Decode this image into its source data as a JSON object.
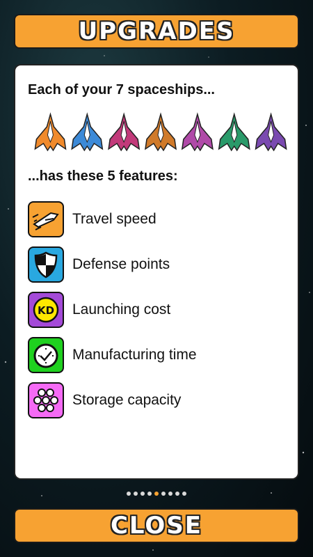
{
  "header": {
    "title": "UPGRADES"
  },
  "card": {
    "ships_heading": "Each of your 7 spaceships...",
    "features_heading": "...has these 5 features:",
    "ships": [
      {
        "icon": "ship-1-icon",
        "color": "#f08a2c"
      },
      {
        "icon": "ship-2-icon",
        "color": "#3c8ad8"
      },
      {
        "icon": "ship-3-icon",
        "color": "#c23a7a"
      },
      {
        "icon": "ship-4-icon",
        "color": "#d07a2a"
      },
      {
        "icon": "ship-5-icon",
        "color": "#b04aa8"
      },
      {
        "icon": "ship-6-icon",
        "color": "#2a9a6a"
      },
      {
        "icon": "ship-7-icon",
        "color": "#7a4ab0"
      }
    ],
    "features": [
      {
        "label": "Travel speed",
        "icon": "speed-ship-icon",
        "color": "#f7a232"
      },
      {
        "label": "Defense points",
        "icon": "shield-icon",
        "color": "#29a8e0"
      },
      {
        "label": "Launching cost",
        "icon": "kd-coin-icon",
        "color": "#a44ad8"
      },
      {
        "label": "Manufacturing time",
        "icon": "clock-icon",
        "color": "#1fd11f"
      },
      {
        "label": "Storage capacity",
        "icon": "storage-grid-icon",
        "color": "#f56af5"
      }
    ]
  },
  "pagination": {
    "count": 9,
    "active_index": 4
  },
  "footer": {
    "close_label": "CLOSE"
  }
}
